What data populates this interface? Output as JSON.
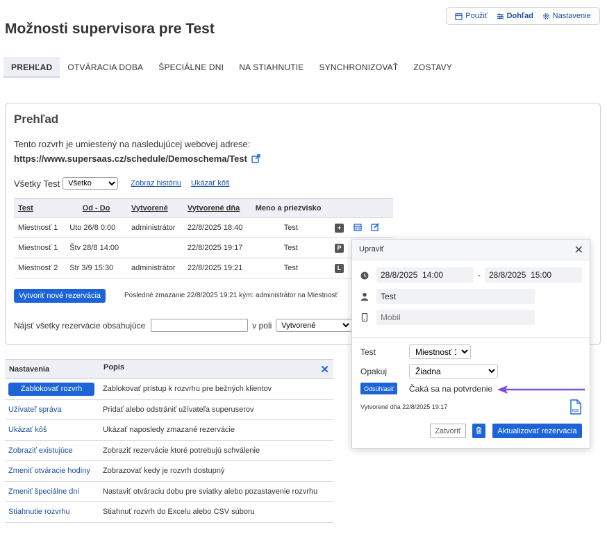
{
  "topnav": {
    "use_label": "Použiť",
    "dashboard_label": "Dohľad",
    "settings_label": "Nastavenie"
  },
  "page_title": "Možnosti supervisora pre Test",
  "tabs": [
    {
      "label": "PREHĽAD",
      "active": true
    },
    {
      "label": "OTVÁRACIA DOBA"
    },
    {
      "label": "ŠPECIÁLNE DNI"
    },
    {
      "label": "NA STIAHNUTIE"
    },
    {
      "label": "SYNCHRONIZOVAŤ"
    },
    {
      "label": "ZOSTAVY"
    }
  ],
  "overview": {
    "title": "Prehľad",
    "desc": "Tento rozvrh je umiestený na nasledujúcej webovej adrese:",
    "url": "https://www.supersaas.cz/schedule/Demoschema/Test",
    "filter_label": "Všetky Test",
    "filter_value": "Všetko",
    "history_link": "Zobraz históriu",
    "trash_link": "Ukázať kôš",
    "columns": [
      "Test",
      "Od - Do",
      "Vytvorené",
      "Vytvorené dňa",
      "Meno a priezvisko"
    ],
    "rows": [
      {
        "resource": "Miestnosť 1",
        "time": "Uto 26/8 0:00",
        "by": "administrátor",
        "created": "22/8/2025 18:40",
        "name": "Test",
        "badge": "+"
      },
      {
        "resource": "Miestnosť 1",
        "time": "Štv 28/8 14:00",
        "by": "",
        "created": "22/8/2025 19:17",
        "name": "Test",
        "badge": "P"
      },
      {
        "resource": "Miestnosť 2",
        "time": "Str 3/9 15:30",
        "by": "administrátor",
        "created": "22/8/2025 19:21",
        "name": "Test",
        "badge": "L"
      }
    ],
    "new_booking_button": "Vytvoriť nové rezervácia",
    "last_deleted": "Posledné zmazanie 22/8/2025 19:21 kým: administrátor na Miestnosť",
    "search_label": "Nájsť všetky rezervácie obsahujúce",
    "search_value": "",
    "in_field_label": "v poli",
    "field_value": "Vytvorené"
  },
  "settings": {
    "col_settings": "Nastavenia",
    "col_desc": "Popis",
    "rows": [
      {
        "action": "Zablokovať rozvrh",
        "desc": "Zablokovať prístup k rozvrhu pre bežných klientov"
      },
      {
        "action": "Užívateľ správa",
        "desc": "Pridať alebo odstrániť užívateľa superuserov"
      },
      {
        "action": "Ukázať kôš",
        "desc": "Ukázať naposledy zmazané rezervácie"
      },
      {
        "action": "Zobraziť existujúce",
        "desc": "Zobraziť rezervácie ktoré potrebujú schválenie"
      },
      {
        "action": "Zmeniť otváracie hodiny",
        "desc": "Zobrazovať kedy je rozvrh dostupný"
      },
      {
        "action": "Zmeniť špeciálne dni",
        "desc": "Nastaviť otváraciu dobu pre sviatky alebo pozastavenie rozvrhu"
      },
      {
        "action": "Stiahnutie rozvrhu",
        "desc": "Stiahnuť rozvrh do Excelu alebo CSV súboru"
      }
    ]
  },
  "dialog": {
    "title": "Upraviť",
    "start": "28/8/2025  14:00",
    "dash": "-",
    "end": "28/8/2025  15:00",
    "name": "Test",
    "mobile_placeholder": "Mobil",
    "resource_label": "Test",
    "resource_value": "Miestnosť 1",
    "repeat_label": "Opakuj",
    "repeat_value": "Žiadna",
    "approve_button": "Odsúhlasiť",
    "status": "Čaká sa na potvrdenie",
    "created": "Vytvorené dňa 22/8/2025 19:17",
    "ics_label": "ICS",
    "close_button": "Zatvoriť",
    "update_button": "Aktualizovať rezervácia"
  },
  "colors": {
    "accent": "#1d64d8",
    "link": "#1b4fa5",
    "arrow": "#7b4fd6"
  }
}
